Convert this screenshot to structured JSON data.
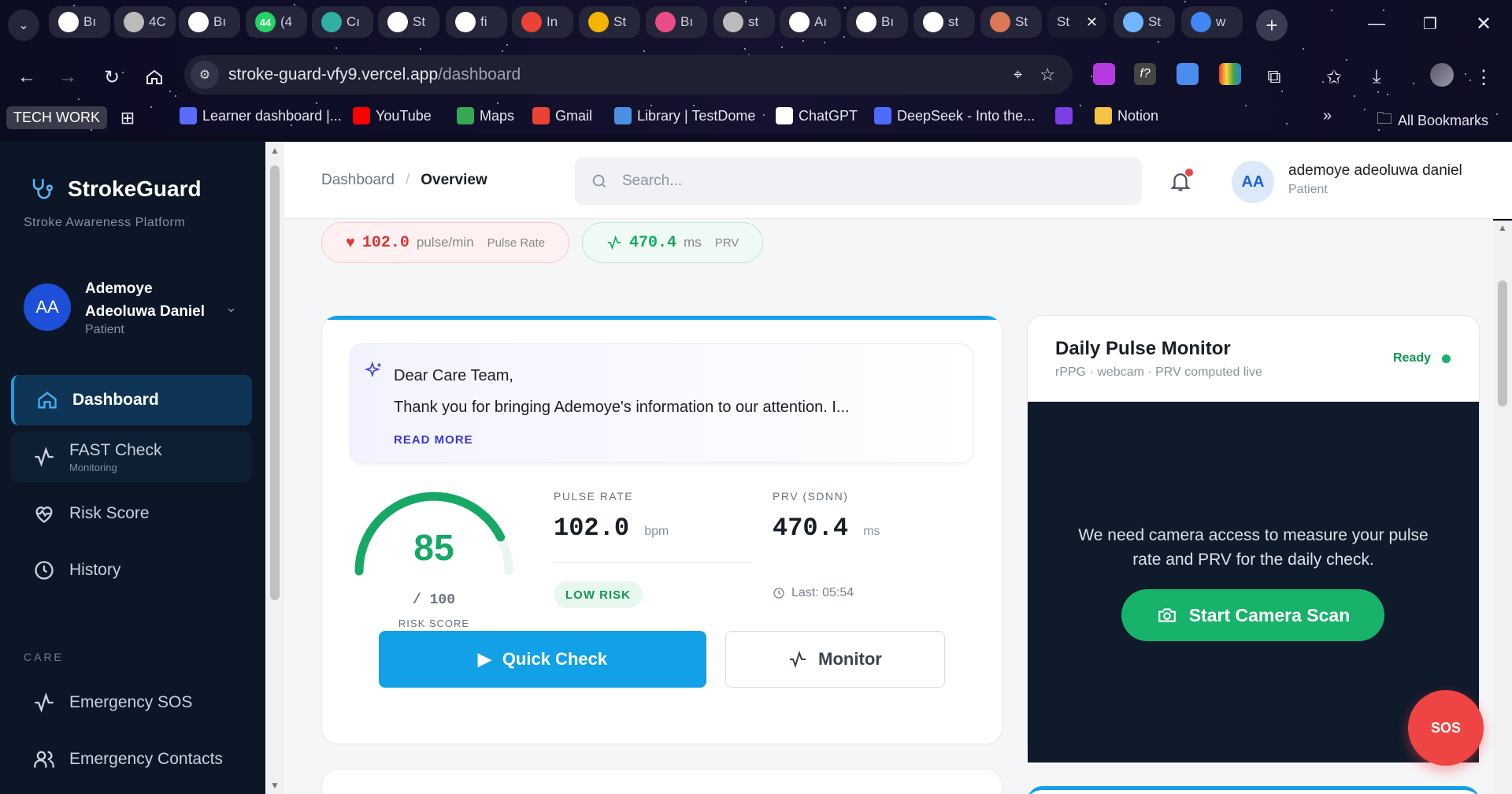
{
  "browser": {
    "tabs": [
      {
        "icon": "github-icon",
        "label": "Bı",
        "color": "#ffffff"
      },
      {
        "icon": "globe-icon",
        "label": "4C",
        "color": "#bbbbbb"
      },
      {
        "icon": "github-icon",
        "label": "Bı",
        "color": "#ffffff"
      },
      {
        "icon": "whatsapp-icon",
        "label": "(4",
        "badge": "44",
        "color": "#25d366"
      },
      {
        "icon": "app-icon",
        "label": "Cı",
        "color": "#2fb0a3"
      },
      {
        "icon": "app-icon",
        "label": "St",
        "color": "#ffffff"
      },
      {
        "icon": "github-icon",
        "label": "fi",
        "color": "#ffffff"
      },
      {
        "icon": "gmail-icon",
        "label": "In",
        "color": "#ea4335"
      },
      {
        "icon": "slides-icon",
        "label": "St",
        "color": "#f4b400"
      },
      {
        "icon": "dribbble-icon",
        "label": "Bı",
        "color": "#ea4c89"
      },
      {
        "icon": "globe-icon",
        "label": "st",
        "color": "#bbbbbb"
      },
      {
        "icon": "openai-icon",
        "label": "Aı",
        "color": "#ffffff"
      },
      {
        "icon": "github-icon",
        "label": "Bı",
        "color": "#ffffff"
      },
      {
        "icon": "vercel-icon",
        "label": "st",
        "color": "#ffffff"
      },
      {
        "icon": "claude-icon",
        "label": "St",
        "color": "#d97757"
      },
      {
        "icon": "",
        "label": "St",
        "active": true,
        "close": "✕"
      },
      {
        "icon": "strokeguard-icon",
        "label": "St",
        "color": "#6fb6ff"
      },
      {
        "icon": "google-icon",
        "label": "w",
        "color": "#4285f4"
      }
    ],
    "url_host": "stroke-guard-vfy9.vercel.app",
    "url_path": "/dashboard",
    "bookmarks_folder": "TECH WORK",
    "bookmarks": [
      {
        "label": "Learner dashboard |...",
        "icon": "bookmark-icon",
        "color": "#5a6cff"
      },
      {
        "label": "YouTube",
        "icon": "youtube-icon",
        "color": "#ff0000"
      },
      {
        "label": "Maps",
        "icon": "maps-icon",
        "color": "#34a853"
      },
      {
        "label": "Gmail",
        "icon": "gmail-icon",
        "color": "#ea4335"
      },
      {
        "label": "Library | TestDome",
        "icon": "testdome-icon",
        "color": "#4a90e2"
      },
      {
        "label": "ChatGPT",
        "icon": "openai-icon",
        "color": "#ffffff"
      },
      {
        "label": "DeepSeek - Into the...",
        "icon": "deepseek-icon",
        "color": "#4d6bfe"
      },
      {
        "label": "",
        "icon": "app-icon",
        "color": "#7b3fe4"
      },
      {
        "label": "Notion",
        "icon": "notion-icon",
        "color": "#f5c242"
      }
    ],
    "bookmarks_overflow": "»",
    "all_bookmarks": "All Bookmarks"
  },
  "sidebar": {
    "brand": "StrokeGuard",
    "tagline": "Stroke Awareness Platform",
    "user": {
      "initials": "AA",
      "name_line1": "Ademoye",
      "name_line2": "Adeoluwa Daniel",
      "role": "Patient"
    },
    "items": [
      {
        "label": "Dashboard",
        "icon": "home-icon"
      },
      {
        "label": "FAST Check",
        "sub": "Monitoring",
        "icon": "activity-icon"
      },
      {
        "label": "Risk Score",
        "icon": "heart-pulse-icon"
      },
      {
        "label": "History",
        "icon": "clock-icon"
      }
    ],
    "section_care": "CARE",
    "care_items": [
      {
        "label": "Emergency SOS",
        "icon": "activity-icon"
      },
      {
        "label": "Emergency Contacts",
        "icon": "users-icon"
      }
    ]
  },
  "header": {
    "breadcrumb_root": "Dashboard",
    "breadcrumb_sep": "/",
    "breadcrumb_current": "Overview",
    "search_placeholder": "Search...",
    "user_initials": "AA",
    "user_name": "ademoye adeoluwa daniel",
    "user_role": "Patient"
  },
  "chips": {
    "pulse": {
      "value": "102.0",
      "unit": "pulse/min",
      "label": "Pulse Rate"
    },
    "prv": {
      "value": "470.4",
      "unit": "ms",
      "label": "PRV"
    }
  },
  "letter": {
    "greeting": "Dear Care Team,",
    "body": "Thank you for bringing Ademoye's information to our attention. I...",
    "read_more": "READ MORE"
  },
  "risk": {
    "score": "85",
    "denominator": "/ 100",
    "label": "RISK SCORE",
    "fraction": 0.85,
    "color": "#17a866",
    "pulse_label": "PULSE RATE",
    "pulse_value": "102.0",
    "pulse_unit": "bpm",
    "prv_label": "PRV (SDNN)",
    "prv_value": "470.4",
    "prv_unit": "ms",
    "risk_level": "LOW RISK",
    "last_updated": "Last: 05:54"
  },
  "actions": {
    "quick_check": "Quick Check",
    "monitor": "Monitor"
  },
  "monitor_card": {
    "title": "Daily Pulse Monitor",
    "subtitle": "rPPG · webcam · PRV computed live",
    "status": "Ready",
    "message": "We need camera access to measure your pulse rate and PRV for the daily check.",
    "cta": "Start Camera Scan"
  },
  "sos": "SOS"
}
